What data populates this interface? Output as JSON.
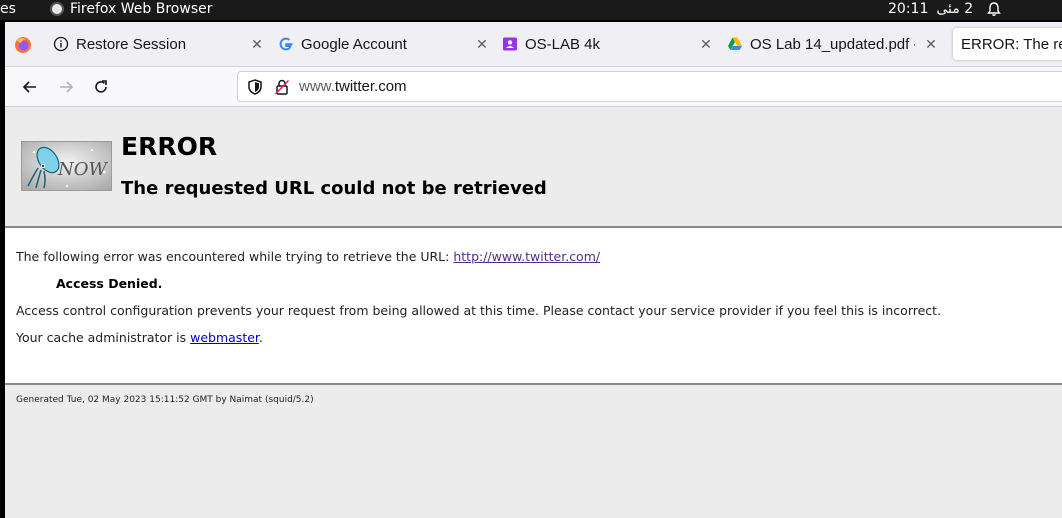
{
  "system_bar": {
    "activities_label": "es",
    "app_name": "Firefox Web Browser",
    "time": "20:11",
    "date": "2 مئی"
  },
  "tabs": [
    {
      "title": "Restore Session",
      "icon": "info-icon"
    },
    {
      "title": "Google Account",
      "icon": "google-icon"
    },
    {
      "title": "OS-LAB 4k",
      "icon": "classroom-icon"
    },
    {
      "title": "OS Lab 14_updated.pdf -",
      "icon": "google-drive-icon"
    },
    {
      "title": "ERROR: The rec",
      "icon": "none",
      "active": true
    }
  ],
  "navbar": {
    "url_prefix": "www.",
    "url_host": "twitter.com"
  },
  "page": {
    "title": "ERROR",
    "subtitle": "The requested URL could not be retrieved",
    "logo_text": "NOW",
    "error_intro": "The following error was encountered while trying to retrieve the URL: ",
    "error_url": "http://www.twitter.com/",
    "denied": "Access Denied.",
    "explanation": "Access control configuration prevents your request from being allowed at this time. Please contact your service provider if you feel this is incorrect.",
    "admin_prefix": "Your cache administrator is ",
    "admin_link": "webmaster",
    "admin_suffix": ".",
    "footer": "Generated Tue, 02 May 2023 15:11:52 GMT by Naimat (squid/5.2)"
  },
  "colors": {
    "visited_link": "#5a2a8a",
    "link": "#0000cc",
    "page_bg": "#ececec"
  }
}
